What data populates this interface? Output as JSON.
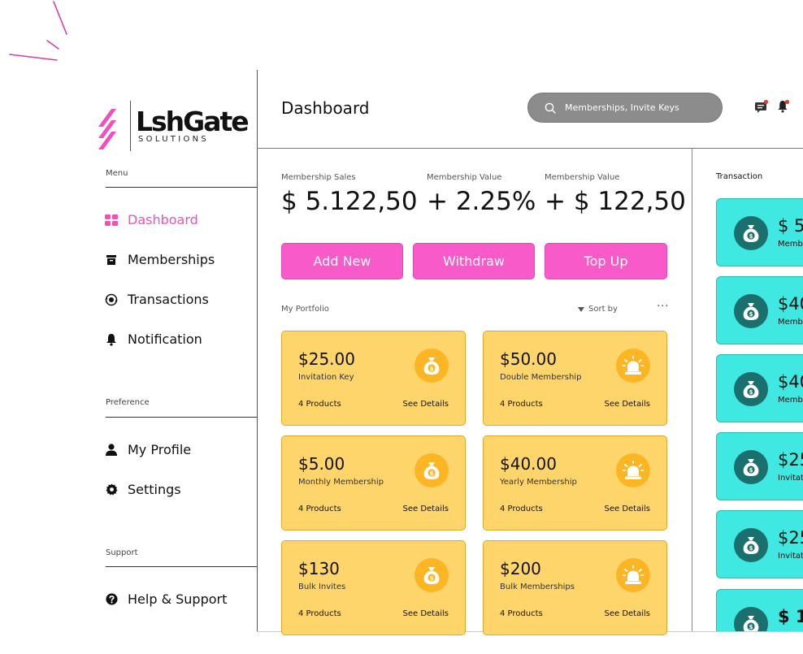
{
  "brand": {
    "name": "LshGate",
    "subtitle": "SOLUTIONS"
  },
  "sidebar": {
    "menu_label": "Menu",
    "menu_items": [
      {
        "label": "Dashboard",
        "icon": "grid-icon",
        "active": true
      },
      {
        "label": "Memberships",
        "icon": "box-icon",
        "active": false
      },
      {
        "label": "Transactions",
        "icon": "exchange-icon",
        "active": false
      },
      {
        "label": "Notification",
        "icon": "bell-icon",
        "active": false
      }
    ],
    "preference_label": "Preference",
    "preference_items": [
      {
        "label": "My Profile",
        "icon": "user-icon"
      },
      {
        "label": "Settings",
        "icon": "gear-icon"
      }
    ],
    "support_label": "Support",
    "support_items": [
      {
        "label": "Help & Support",
        "icon": "help-icon"
      }
    ]
  },
  "header": {
    "title": "Dashboard",
    "search_placeholder": "Memberships, Invite Keys"
  },
  "stats": [
    {
      "label": "Membership Sales",
      "value": "$ 5.122,50"
    },
    {
      "label": "Membership Value",
      "value": "+ 2.25%"
    },
    {
      "label": "Membership Value",
      "value": "+ $ 122,50"
    }
  ],
  "actions": {
    "add_new": "Add New",
    "withdraw": "Withdraw",
    "top_up": "Top Up"
  },
  "portfolio": {
    "label": "My Portfolio",
    "sort_label": "Sort by",
    "more": "···",
    "cards": [
      {
        "price": "$25.00",
        "desc": "Invitation Key",
        "count": "4 Products",
        "details": "See Details",
        "icon": "money-bag-icon"
      },
      {
        "price": "$50.00",
        "desc": "Double Membership",
        "count": "4 Products",
        "details": "See Details",
        "icon": "siren-icon"
      },
      {
        "price": "$5.00",
        "desc": "Monthly Membership",
        "count": "4 Products",
        "details": "See Details",
        "icon": "money-bag-icon"
      },
      {
        "price": "$40.00",
        "desc": "Yearly Membership",
        "count": "4 Products",
        "details": "See Details",
        "icon": "siren-icon"
      },
      {
        "price": "$130",
        "desc": "Bulk Invites",
        "count": "4 Products",
        "details": "See Details",
        "icon": "money-bag-icon"
      },
      {
        "price": "$200",
        "desc": "Bulk Memberships",
        "count": "4 Products",
        "details": "See Details",
        "icon": "siren-icon"
      }
    ]
  },
  "transactions": {
    "label": "Transaction",
    "items": [
      {
        "amount": "$ 5",
        "sub": "Memb"
      },
      {
        "amount": "$40",
        "sub": "Memb"
      },
      {
        "amount": "$40",
        "sub": "Memb"
      },
      {
        "amount": "$25",
        "sub": "Invitat"
      },
      {
        "amount": "$25",
        "sub": "Invitat"
      },
      {
        "amount": "$ 1.",
        "sub": ""
      }
    ]
  },
  "colors": {
    "accent_pink": "#f95ac9",
    "card_yellow": "#fdd56b",
    "card_icon_orange": "#fdb623",
    "tx_cyan": "#3fe8e0",
    "tx_icon_teal": "#1b6f6c",
    "search_gray": "#8c8c8c"
  }
}
